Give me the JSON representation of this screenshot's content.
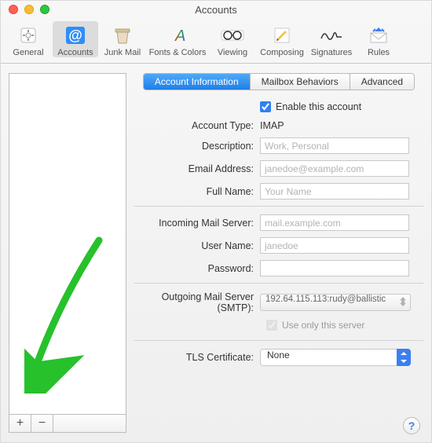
{
  "window": {
    "title": "Accounts"
  },
  "toolbar": {
    "items": [
      {
        "label": "General"
      },
      {
        "label": "Accounts"
      },
      {
        "label": "Junk Mail"
      },
      {
        "label": "Fonts & Colors"
      },
      {
        "label": "Viewing"
      },
      {
        "label": "Composing"
      },
      {
        "label": "Signatures"
      },
      {
        "label": "Rules"
      }
    ]
  },
  "tabs": {
    "account_info": "Account Information",
    "mailbox_behaviors": "Mailbox Behaviors",
    "advanced": "Advanced"
  },
  "form": {
    "enable_label": "Enable this account",
    "account_type_label": "Account Type:",
    "account_type_value": "IMAP",
    "description_label": "Description:",
    "description_placeholder": "Work, Personal",
    "email_label": "Email Address:",
    "email_placeholder": "janedoe@example.com",
    "fullname_label": "Full Name:",
    "fullname_placeholder": "Your Name",
    "incoming_label": "Incoming Mail Server:",
    "incoming_placeholder": "mail.example.com",
    "username_label": "User Name:",
    "username_placeholder": "janedoe",
    "password_label": "Password:",
    "smtp_label": "Outgoing Mail Server (SMTP):",
    "smtp_value": "192.64.115.113:rudy@ballistic",
    "use_only_label": "Use only this server",
    "tls_label": "TLS Certificate:",
    "tls_value": "None"
  },
  "buttons": {
    "add": "+",
    "remove": "−",
    "help": "?"
  }
}
